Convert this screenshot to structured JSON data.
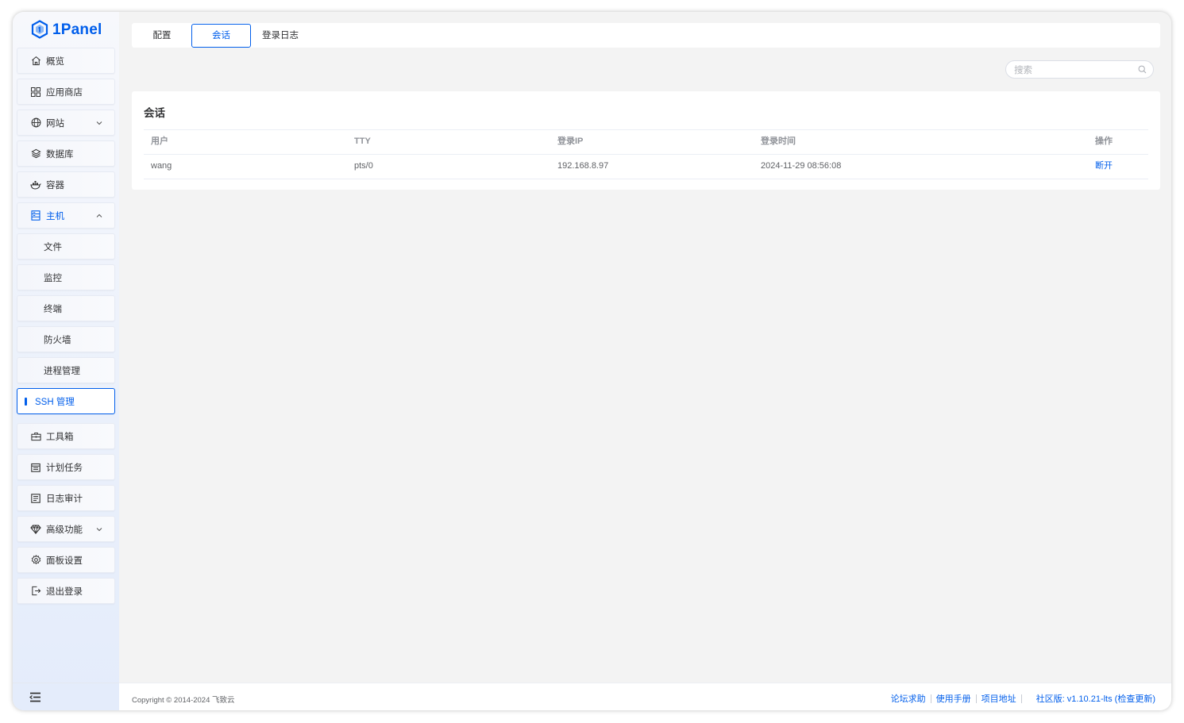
{
  "brand": {
    "name": "1Panel",
    "color": "#005eeb"
  },
  "sidebar": {
    "items": [
      {
        "label": "概览",
        "icon": "home-icon"
      },
      {
        "label": "应用商店",
        "icon": "grid-icon"
      },
      {
        "label": "网站",
        "icon": "globe-icon",
        "expandable": true
      },
      {
        "label": "数据库",
        "icon": "layers-icon"
      },
      {
        "label": "容器",
        "icon": "docker-icon"
      },
      {
        "label": "主机",
        "icon": "server-icon",
        "expanded": true
      },
      {
        "label": "文件"
      },
      {
        "label": "监控"
      },
      {
        "label": "终端"
      },
      {
        "label": "防火墙"
      },
      {
        "label": "进程管理"
      },
      {
        "label": "SSH 管理",
        "active": true
      },
      {
        "label": "工具箱",
        "icon": "toolbox-icon"
      },
      {
        "label": "计划任务",
        "icon": "calendar-icon"
      },
      {
        "label": "日志审计",
        "icon": "log-icon"
      },
      {
        "label": "高级功能",
        "icon": "diamond-icon",
        "expandable": true
      },
      {
        "label": "面板设置",
        "icon": "gear-icon"
      },
      {
        "label": "退出登录",
        "icon": "logout-icon"
      }
    ]
  },
  "tabs": [
    {
      "label": "配置"
    },
    {
      "label": "会话",
      "active": true
    },
    {
      "label": "登录日志"
    }
  ],
  "search": {
    "placeholder": "搜索",
    "value": ""
  },
  "sessions": {
    "title": "会话",
    "columns": [
      "用户",
      "TTY",
      "登录IP",
      "登录时间",
      "操作"
    ],
    "rows": [
      {
        "user": "wang",
        "tty": "pts/0",
        "ip": "192.168.8.97",
        "time": "2024-11-29 08:56:08",
        "action": "断开"
      }
    ]
  },
  "footer": {
    "copyright": "Copyright © 2014-2024 飞致云",
    "links": [
      "论坛求助",
      "使用手册",
      "项目地址"
    ],
    "version": "社区版: v1.10.21-lts (检查更新)"
  }
}
